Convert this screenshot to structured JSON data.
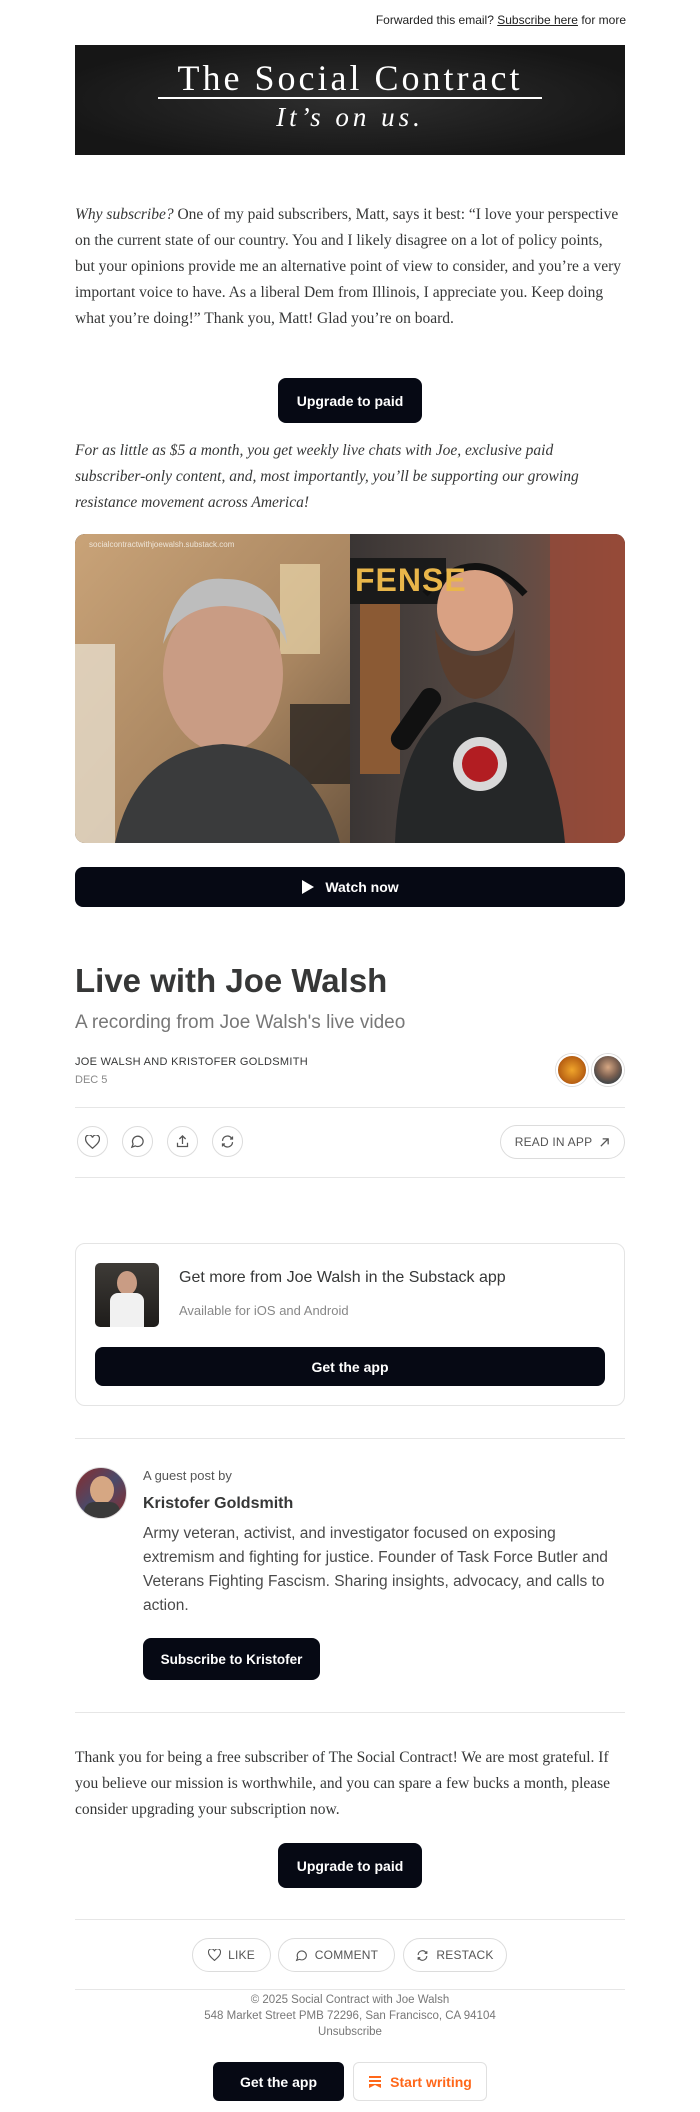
{
  "forward": {
    "prefix": "Forwarded this email?",
    "link": "Subscribe here",
    "suffix": "for more"
  },
  "banner": {
    "title": "The Social Contract",
    "tagline": "It’s on us."
  },
  "intro": {
    "lead": "Why subscribe?",
    "text": " One of my paid subscribers, Matt, says it best: “I love your perspective on the current state of our country. You and I likely disagree on a lot of policy points, but your opinions provide me an alternative point of view to consider, and you’re a very important voice to have. As a liberal Dem from Illinois, I appreciate you. Keep doing what you’re doing!” Thank you, Matt! Glad you’re on board."
  },
  "upgrade_button": "Upgrade to paid",
  "promo_text": "For as little as $5 a month, you get weekly live chats with Joe, exclusive paid subscriber-only content, and, most importantly, you’ll be supporting our growing resistance movement across America!",
  "video": {
    "url_overlay": "socialcontractwithjoewalsh.substack.com",
    "sign_text": "FENSE",
    "watch_label": "Watch now"
  },
  "post": {
    "title": "Live with Joe Walsh",
    "subtitle": "A recording from Joe Walsh's live video",
    "authors": "JOE WALSH AND KRISTOFER GOLDSMITH",
    "date": "DEC 5",
    "read_in_app": "READ IN APP"
  },
  "app_promo": {
    "title": "Get more from Joe Walsh in the Substack app",
    "subtitle": "Available for iOS and Android",
    "button": "Get the app"
  },
  "guest": {
    "label": "A guest post by",
    "name": "Kristofer Goldsmith",
    "bio": "Army veteran, activist, and investigator focused on exposing extremism and fighting for justice. Founder of Task Force Butler and Veterans Fighting Fascism. Sharing insights, advocacy, and calls to action.",
    "button": "Subscribe to Kristofer"
  },
  "thanks_text": "Thank you for being a free subscriber of The Social Contract! We are most grateful. If you believe our mission is worthwhile, and you can spare a few bucks a month, please consider upgrading your subscription now.",
  "upgrade_button_2": "Upgrade to paid",
  "actions": {
    "like": "LIKE",
    "comment": "COMMENT",
    "restack": "RESTACK"
  },
  "footer": {
    "copyright": "© 2025 Social Contract with Joe Walsh",
    "address": "548 Market Street PMB 72296, San Francisco, CA 94104",
    "unsubscribe": "Unsubscribe",
    "get_app": "Get the app",
    "start_writing": "Start writing"
  },
  "colors": {
    "dark": "#060914",
    "accent_orange": "#ff6719",
    "banner_bg": "#1b1b1b"
  }
}
